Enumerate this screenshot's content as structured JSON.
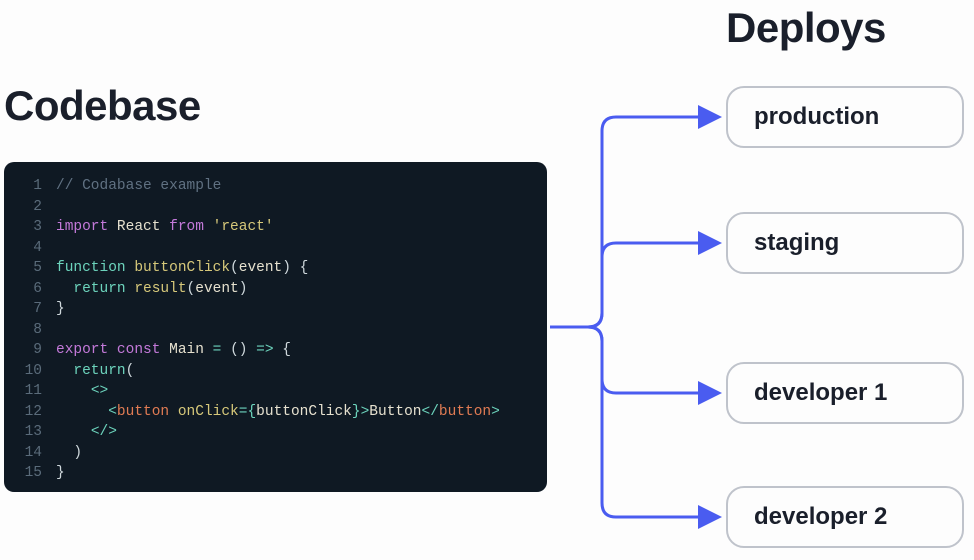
{
  "headings": {
    "codebase": "Codebase",
    "deploys": "Deploys"
  },
  "deploy_targets": {
    "production": "production",
    "staging": "staging",
    "developer1": "developer 1",
    "developer2": "developer 2"
  },
  "code": {
    "lines": [
      {
        "n": "1",
        "tokens": [
          {
            "c": "cm",
            "t": "// Codabase example"
          }
        ]
      },
      {
        "n": "2",
        "tokens": []
      },
      {
        "n": "3",
        "tokens": [
          {
            "c": "kw2",
            "t": "import"
          },
          {
            "c": "",
            "t": " "
          },
          {
            "c": "nm",
            "t": "React"
          },
          {
            "c": "",
            "t": " "
          },
          {
            "c": "kw2",
            "t": "from"
          },
          {
            "c": "",
            "t": " "
          },
          {
            "c": "str",
            "t": "'react'"
          }
        ]
      },
      {
        "n": "4",
        "tokens": []
      },
      {
        "n": "5",
        "tokens": [
          {
            "c": "kw",
            "t": "function"
          },
          {
            "c": "",
            "t": " "
          },
          {
            "c": "fn",
            "t": "buttonClick"
          },
          {
            "c": "paren",
            "t": "("
          },
          {
            "c": "id",
            "t": "event"
          },
          {
            "c": "paren",
            "t": ")"
          },
          {
            "c": "",
            "t": " "
          },
          {
            "c": "br",
            "t": "{"
          }
        ]
      },
      {
        "n": "6",
        "tokens": [
          {
            "c": "",
            "t": "  "
          },
          {
            "c": "kw",
            "t": "return"
          },
          {
            "c": "",
            "t": " "
          },
          {
            "c": "fn",
            "t": "result"
          },
          {
            "c": "paren",
            "t": "("
          },
          {
            "c": "id",
            "t": "event"
          },
          {
            "c": "paren",
            "t": ")"
          }
        ]
      },
      {
        "n": "7",
        "tokens": [
          {
            "c": "br",
            "t": "}"
          }
        ]
      },
      {
        "n": "8",
        "tokens": []
      },
      {
        "n": "9",
        "tokens": [
          {
            "c": "kw2",
            "t": "export"
          },
          {
            "c": "",
            "t": " "
          },
          {
            "c": "kw2",
            "t": "const"
          },
          {
            "c": "",
            "t": " "
          },
          {
            "c": "nm",
            "t": "Main"
          },
          {
            "c": "",
            "t": " "
          },
          {
            "c": "op",
            "t": "="
          },
          {
            "c": "",
            "t": " "
          },
          {
            "c": "paren",
            "t": "()"
          },
          {
            "c": "",
            "t": " "
          },
          {
            "c": "op",
            "t": "=>"
          },
          {
            "c": "",
            "t": " "
          },
          {
            "c": "br",
            "t": "{"
          }
        ]
      },
      {
        "n": "10",
        "tokens": [
          {
            "c": "",
            "t": "  "
          },
          {
            "c": "kw",
            "t": "return"
          },
          {
            "c": "paren",
            "t": "("
          }
        ]
      },
      {
        "n": "11",
        "tokens": [
          {
            "c": "",
            "t": "    "
          },
          {
            "c": "op",
            "t": "<>"
          }
        ]
      },
      {
        "n": "12",
        "tokens": [
          {
            "c": "",
            "t": "      "
          },
          {
            "c": "op",
            "t": "<"
          },
          {
            "c": "tag",
            "t": "button"
          },
          {
            "c": "",
            "t": " "
          },
          {
            "c": "attr",
            "t": "onClick"
          },
          {
            "c": "op",
            "t": "={"
          },
          {
            "c": "id",
            "t": "buttonClick"
          },
          {
            "c": "op",
            "t": "}>"
          },
          {
            "c": "txt",
            "t": "Button"
          },
          {
            "c": "op",
            "t": "</"
          },
          {
            "c": "tag",
            "t": "button"
          },
          {
            "c": "op",
            "t": ">"
          }
        ]
      },
      {
        "n": "13",
        "tokens": [
          {
            "c": "",
            "t": "    "
          },
          {
            "c": "op",
            "t": "</>"
          }
        ]
      },
      {
        "n": "14",
        "tokens": [
          {
            "c": "",
            "t": "  "
          },
          {
            "c": "paren",
            "t": ")"
          }
        ]
      },
      {
        "n": "15",
        "tokens": [
          {
            "c": "br",
            "t": "}"
          }
        ]
      }
    ]
  },
  "colors": {
    "arrow": "#4a5cf0",
    "code_bg": "#0f1923",
    "border": "#bfc3cb",
    "text": "#1a1f2b"
  }
}
